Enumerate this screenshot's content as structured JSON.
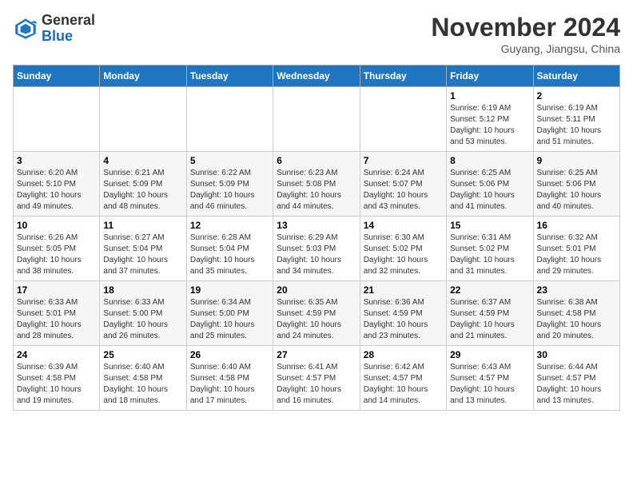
{
  "header": {
    "logo_line1": "General",
    "logo_line2": "Blue",
    "month": "November 2024",
    "location": "Guyang, Jiangsu, China"
  },
  "weekdays": [
    "Sunday",
    "Monday",
    "Tuesday",
    "Wednesday",
    "Thursday",
    "Friday",
    "Saturday"
  ],
  "weeks": [
    [
      {
        "day": "",
        "info": ""
      },
      {
        "day": "",
        "info": ""
      },
      {
        "day": "",
        "info": ""
      },
      {
        "day": "",
        "info": ""
      },
      {
        "day": "",
        "info": ""
      },
      {
        "day": "1",
        "info": "Sunrise: 6:19 AM\nSunset: 5:12 PM\nDaylight: 10 hours and 53 minutes."
      },
      {
        "day": "2",
        "info": "Sunrise: 6:19 AM\nSunset: 5:11 PM\nDaylight: 10 hours and 51 minutes."
      }
    ],
    [
      {
        "day": "3",
        "info": "Sunrise: 6:20 AM\nSunset: 5:10 PM\nDaylight: 10 hours and 49 minutes."
      },
      {
        "day": "4",
        "info": "Sunrise: 6:21 AM\nSunset: 5:09 PM\nDaylight: 10 hours and 48 minutes."
      },
      {
        "day": "5",
        "info": "Sunrise: 6:22 AM\nSunset: 5:09 PM\nDaylight: 10 hours and 46 minutes."
      },
      {
        "day": "6",
        "info": "Sunrise: 6:23 AM\nSunset: 5:08 PM\nDaylight: 10 hours and 44 minutes."
      },
      {
        "day": "7",
        "info": "Sunrise: 6:24 AM\nSunset: 5:07 PM\nDaylight: 10 hours and 43 minutes."
      },
      {
        "day": "8",
        "info": "Sunrise: 6:25 AM\nSunset: 5:06 PM\nDaylight: 10 hours and 41 minutes."
      },
      {
        "day": "9",
        "info": "Sunrise: 6:25 AM\nSunset: 5:06 PM\nDaylight: 10 hours and 40 minutes."
      }
    ],
    [
      {
        "day": "10",
        "info": "Sunrise: 6:26 AM\nSunset: 5:05 PM\nDaylight: 10 hours and 38 minutes."
      },
      {
        "day": "11",
        "info": "Sunrise: 6:27 AM\nSunset: 5:04 PM\nDaylight: 10 hours and 37 minutes."
      },
      {
        "day": "12",
        "info": "Sunrise: 6:28 AM\nSunset: 5:04 PM\nDaylight: 10 hours and 35 minutes."
      },
      {
        "day": "13",
        "info": "Sunrise: 6:29 AM\nSunset: 5:03 PM\nDaylight: 10 hours and 34 minutes."
      },
      {
        "day": "14",
        "info": "Sunrise: 6:30 AM\nSunset: 5:02 PM\nDaylight: 10 hours and 32 minutes."
      },
      {
        "day": "15",
        "info": "Sunrise: 6:31 AM\nSunset: 5:02 PM\nDaylight: 10 hours and 31 minutes."
      },
      {
        "day": "16",
        "info": "Sunrise: 6:32 AM\nSunset: 5:01 PM\nDaylight: 10 hours and 29 minutes."
      }
    ],
    [
      {
        "day": "17",
        "info": "Sunrise: 6:33 AM\nSunset: 5:01 PM\nDaylight: 10 hours and 28 minutes."
      },
      {
        "day": "18",
        "info": "Sunrise: 6:33 AM\nSunset: 5:00 PM\nDaylight: 10 hours and 26 minutes."
      },
      {
        "day": "19",
        "info": "Sunrise: 6:34 AM\nSunset: 5:00 PM\nDaylight: 10 hours and 25 minutes."
      },
      {
        "day": "20",
        "info": "Sunrise: 6:35 AM\nSunset: 4:59 PM\nDaylight: 10 hours and 24 minutes."
      },
      {
        "day": "21",
        "info": "Sunrise: 6:36 AM\nSunset: 4:59 PM\nDaylight: 10 hours and 23 minutes."
      },
      {
        "day": "22",
        "info": "Sunrise: 6:37 AM\nSunset: 4:59 PM\nDaylight: 10 hours and 21 minutes."
      },
      {
        "day": "23",
        "info": "Sunrise: 6:38 AM\nSunset: 4:58 PM\nDaylight: 10 hours and 20 minutes."
      }
    ],
    [
      {
        "day": "24",
        "info": "Sunrise: 6:39 AM\nSunset: 4:58 PM\nDaylight: 10 hours and 19 minutes."
      },
      {
        "day": "25",
        "info": "Sunrise: 6:40 AM\nSunset: 4:58 PM\nDaylight: 10 hours and 18 minutes."
      },
      {
        "day": "26",
        "info": "Sunrise: 6:40 AM\nSunset: 4:58 PM\nDaylight: 10 hours and 17 minutes."
      },
      {
        "day": "27",
        "info": "Sunrise: 6:41 AM\nSunset: 4:57 PM\nDaylight: 10 hours and 16 minutes."
      },
      {
        "day": "28",
        "info": "Sunrise: 6:42 AM\nSunset: 4:57 PM\nDaylight: 10 hours and 14 minutes."
      },
      {
        "day": "29",
        "info": "Sunrise: 6:43 AM\nSunset: 4:57 PM\nDaylight: 10 hours and 13 minutes."
      },
      {
        "day": "30",
        "info": "Sunrise: 6:44 AM\nSunset: 4:57 PM\nDaylight: 10 hours and 13 minutes."
      }
    ]
  ]
}
